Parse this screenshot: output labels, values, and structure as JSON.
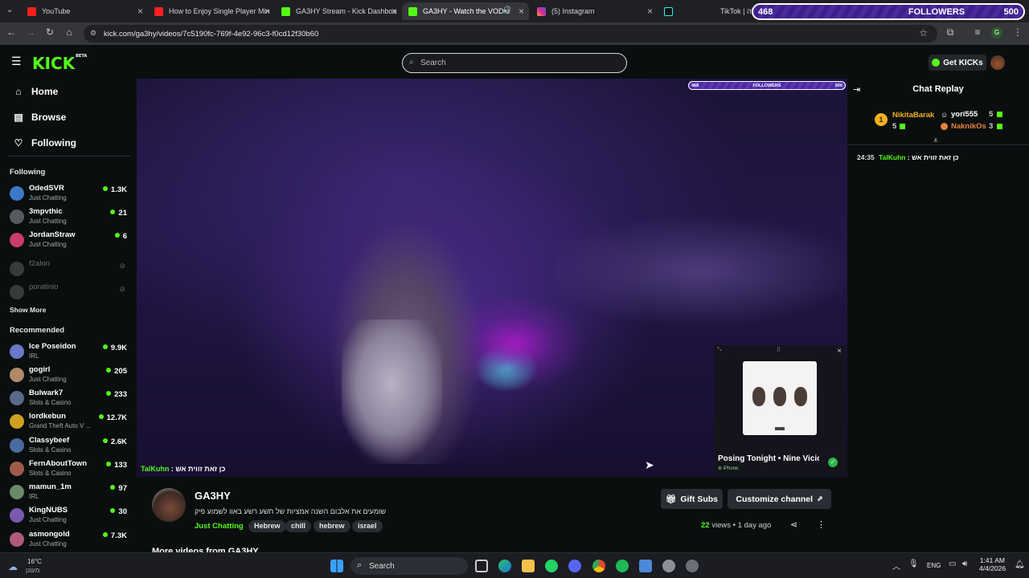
{
  "tabs": [
    {
      "label": "YouTube",
      "icon": "youtube-icon"
    },
    {
      "label": "How to Enjoy Single Player Min",
      "icon": "youtube-icon"
    },
    {
      "label": "GA3HY Stream - Kick Dashboa",
      "icon": "kick-icon"
    },
    {
      "label": "GA3HY - Watch the VOD o",
      "icon": "kick-icon"
    },
    {
      "label": "(5) Instagram",
      "icon": "instagram-icon"
    },
    {
      "label": "",
      "icon": "tiktok-icon"
    },
    {
      "label": "TikTok | זה",
      "icon": ""
    }
  ],
  "followers_overlay": {
    "left": "468",
    "label": "FOLLOWERS",
    "right": "500"
  },
  "address": {
    "url": "kick.com/ga3hy/videos/7c5190fc-769f-4e92-96c3-f0cd12f30b60"
  },
  "header": {
    "logo": "KICK",
    "logo_badge": "BETA",
    "search_placeholder": "Search",
    "get_kicks": "Get KICKs"
  },
  "sidebar": {
    "nav": [
      {
        "label": "Home",
        "icon": "home-icon"
      },
      {
        "label": "Browse",
        "icon": "browse-icon"
      },
      {
        "label": "Following",
        "icon": "heart-icon"
      }
    ],
    "following_title": "Following",
    "following": [
      {
        "name": "OdedSVR",
        "category": "Just Chatting",
        "viewers": "1.3K",
        "color": "#3d78c9"
      },
      {
        "name": "3mpvthic",
        "category": "Just Chatting",
        "viewers": "21",
        "color": "#555a60"
      },
      {
        "name": "JordanStraw",
        "category": "Just Chatting",
        "viewers": "6",
        "color": "#c93d6a"
      },
      {
        "name": "f2alon",
        "category": "",
        "viewers": "",
        "color": "#3a3a3a"
      },
      {
        "name": "poratinio",
        "category": "",
        "viewers": "",
        "color": "#3a3a3a"
      }
    ],
    "show_more": "Show More",
    "recommended_title": "Recommended",
    "recommended": [
      {
        "name": "Ice Poseidon",
        "category": "IRL",
        "viewers": "9.9K",
        "color": "#6a78c9"
      },
      {
        "name": "gogirl",
        "category": "Just Chatting",
        "viewers": "205",
        "color": "#b08a6a"
      },
      {
        "name": "Bulwark7",
        "category": "Slots & Casino",
        "viewers": "233",
        "color": "#5a6a8a"
      },
      {
        "name": "lordkebun",
        "category": "Grand Theft Auto V ...",
        "viewers": "12.7K",
        "color": "#d0a020"
      },
      {
        "name": "Classybeef",
        "category": "Slots & Casino",
        "viewers": "2.6K",
        "color": "#4a6aa0"
      },
      {
        "name": "FernAboutTown",
        "category": "Slots & Casino",
        "viewers": "133",
        "color": "#a05a4a"
      },
      {
        "name": "mamun_1m",
        "category": "IRL",
        "viewers": "97",
        "color": "#6a8a6a"
      },
      {
        "name": "KingNUBS",
        "category": "Just Chatting",
        "viewers": "30",
        "color": "#7a5ab0"
      },
      {
        "name": "asmongold",
        "category": "Just Chatting",
        "viewers": "7.3K",
        "color": "#b05a7a"
      }
    ]
  },
  "video": {
    "mini_followers": {
      "left": "468",
      "label": "FOLLOWERS",
      "right": "500"
    },
    "chat_user": "TalKuhn",
    "chat_text": ": כן זאת זווית אש",
    "now_playing": {
      "title": "Posing Tonight • Nine Vicio",
      "device": "iPhone"
    }
  },
  "channel": {
    "name": "GA3HY",
    "title": "שומעים את אלבום השנה אמציות של תשע רשע באוו לשמוע פיק",
    "category": "Just Chatting",
    "tags": [
      "Hebrew",
      "chill",
      "hebrew",
      "israel"
    ],
    "gift_subs": "Gift Subs",
    "customize": "Customize channel",
    "views_count": "22",
    "views_label": "views",
    "age": "1 day ago",
    "more_videos": "More videos from GA3HY"
  },
  "chat": {
    "title": "Chat Replay",
    "gifters": [
      {
        "rank": "1",
        "name": "NikitaBarak",
        "count": "5"
      },
      {
        "name": "yori555",
        "count": "5"
      },
      {
        "name": "NaknikOs",
        "count": "3"
      }
    ],
    "message": {
      "time": "24:35",
      "user": "TalKuhn",
      "text": ": כן זאת זווית אש"
    }
  },
  "taskbar": {
    "weather_temp": "16°C",
    "weather_desc": "מעונן",
    "search": "Search",
    "lang": "ENG",
    "time": "1:41 AM",
    "date": "4/4/2026"
  },
  "colors": {
    "kick_green": "#53fc18",
    "bg": "#0b0e0f",
    "panel": "#2a2d33"
  }
}
